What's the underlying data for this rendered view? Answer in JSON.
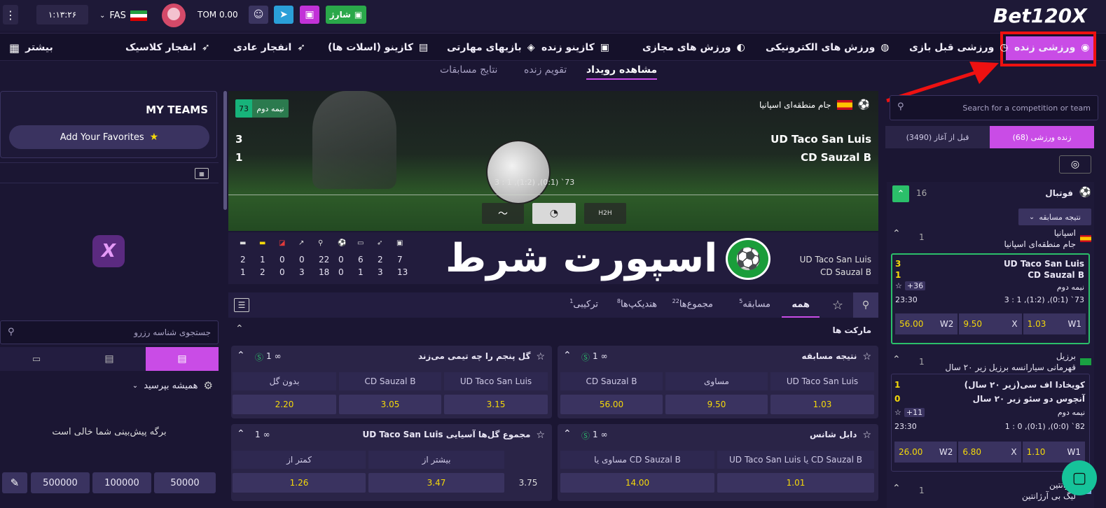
{
  "header": {
    "logo": "Bet120X",
    "charge_label": "شارژ",
    "balance": "TOM 0.00",
    "language": "FAS",
    "clock": "۱:۱۳:۲۶",
    "menu_icon": "kebab-icon"
  },
  "nav": {
    "items": [
      {
        "label": "ورزشی زنده",
        "icon": "live-icon"
      },
      {
        "label": "ورزشی قبل بازی",
        "icon": "stopwatch-icon"
      },
      {
        "label": "ورزش های الکترونیکی",
        "icon": "gamepad-icon"
      },
      {
        "label": "ورزش های مجازی",
        "icon": "virtual-icon"
      },
      {
        "label": "کازینو زنده",
        "icon": "dealer-icon"
      },
      {
        "label": "بازیهای مهارتی",
        "icon": "shield-icon"
      },
      {
        "label": "کازینو (اسلات ها)",
        "icon": "slot-icon"
      },
      {
        "label": "انفجار عادی",
        "icon": "rocket-icon"
      },
      {
        "label": "انفجار کلاسیک",
        "icon": "rocket-icon"
      }
    ],
    "more_label": "بیشتر"
  },
  "subnav": {
    "tabs": [
      "مشاهده رویداد",
      "تقویم زنده",
      "نتایج مسابقات"
    ]
  },
  "right_panel": {
    "search_placeholder": "Search for a competition or team",
    "tab_live": "زنده ورزشی (68)",
    "tab_prematch": "قبل از آغاز (3490)",
    "sport": {
      "name": "فوتبال",
      "count": "16"
    },
    "market_select": "نتیجه مسابقه",
    "leagues": [
      {
        "country": "اسپانیا",
        "league": "جام منطقه‌ای اسپانیا",
        "count": "1",
        "match": {
          "home": "UD Taco San Luis",
          "away": "CD Sauzal B",
          "home_score": "3",
          "away_score": "1",
          "period": "نیمه دوم",
          "markets": "+36",
          "time": "23:30",
          "detail": "3 : 1 ,(1:2) ,(0:1) ‎`73",
          "odds": [
            {
              "label": "W1",
              "value": "1.03"
            },
            {
              "label": "X",
              "value": "9.50"
            },
            {
              "label": "W2",
              "value": "56.00"
            }
          ]
        }
      },
      {
        "country": "برزیل",
        "league": "قهرمانی سیارانسه برزیل زیر ۲۰ سال",
        "count": "1",
        "match": {
          "home": "کویخادا اف سی(زیر ۲۰ سال)",
          "away": "آنچوس دو سئو زیر ۲۰ سال",
          "home_score": "1",
          "away_score": "0",
          "period": "نیمه دوم",
          "markets": "+11",
          "time": "23:30",
          "detail": "1 : 0 ,(0:1) ,(0:0) ‎`82",
          "odds": [
            {
              "label": "W1",
              "value": "1.10"
            },
            {
              "label": "X",
              "value": "6.80"
            },
            {
              "label": "W2",
              "value": "26.00"
            }
          ]
        }
      },
      {
        "country": "آرژانتین",
        "league": "لیگ بی آرژانتین",
        "count": "1"
      }
    ]
  },
  "event": {
    "league": "جام منطقه‌ای اسپانیا",
    "period_badge": "نیمه دوم",
    "minute": "73",
    "home": "UD Taco San Luis",
    "away": "CD Sauzal B",
    "home_score": "3",
    "away_score": "1",
    "score_detail": "3 : 1 ,(1:2) ,(0:1) ‎`73",
    "stats_home": [
      "2",
      "1",
      "0",
      "0",
      "22",
      "0",
      "6",
      "2",
      "7"
    ],
    "stats_away": [
      "1",
      "2",
      "0",
      "3",
      "18",
      "0",
      "1",
      "3",
      "13"
    ],
    "watermark": "اسپورت شرط"
  },
  "market_tabs": {
    "all": "همه",
    "items": [
      {
        "label": "مسابقه",
        "count": "5"
      },
      {
        "label": "مجموع‌ها",
        "count": "22"
      },
      {
        "label": "هندیکپ‌ها",
        "count": "8"
      },
      {
        "label": "ترکیبی",
        "count": "1"
      }
    ],
    "markets_title": "مارکت ها"
  },
  "markets": {
    "result": {
      "title": "نتیجه مسابقه",
      "count": "1",
      "heads": [
        "UD Taco San Luis",
        "مساوی",
        "CD Sauzal B"
      ],
      "odds": [
        "1.03",
        "9.50",
        "56.00"
      ]
    },
    "fifth_goal": {
      "title": "گل پنجم را چه تیمی می‌زند",
      "count": "1",
      "heads": [
        "UD Taco San Luis",
        "CD Sauzal B",
        "بدون گل"
      ],
      "odds": [
        "3.15",
        "3.05",
        "2.20"
      ]
    },
    "double_chance": {
      "title": "دابل شانس",
      "count": "1",
      "heads": [
        "UD Taco San Luis یا CD Sauzal B",
        "مساوی یا CD Sauzal B"
      ],
      "odds": [
        "1.01",
        "14.00"
      ]
    },
    "asian_total": {
      "title": "مجموع گل‌ها آسیایی UD Taco San Luis",
      "count": "1",
      "heads": [
        "بیشتر از",
        "کمتر از"
      ],
      "line": "3.75",
      "odds": [
        "3.47",
        "1.26"
      ]
    }
  },
  "left_panel": {
    "my_teams": "MY TEAMS",
    "add_favorites": "Add Your Favorites",
    "reservation_placeholder": "جستجوی شناسه رزرو",
    "always_ask": "همیشه بپرسید",
    "empty_slip": "برگه پیش‌بینی شما خالی است",
    "stakes": [
      "50000",
      "100000",
      "500000"
    ]
  }
}
